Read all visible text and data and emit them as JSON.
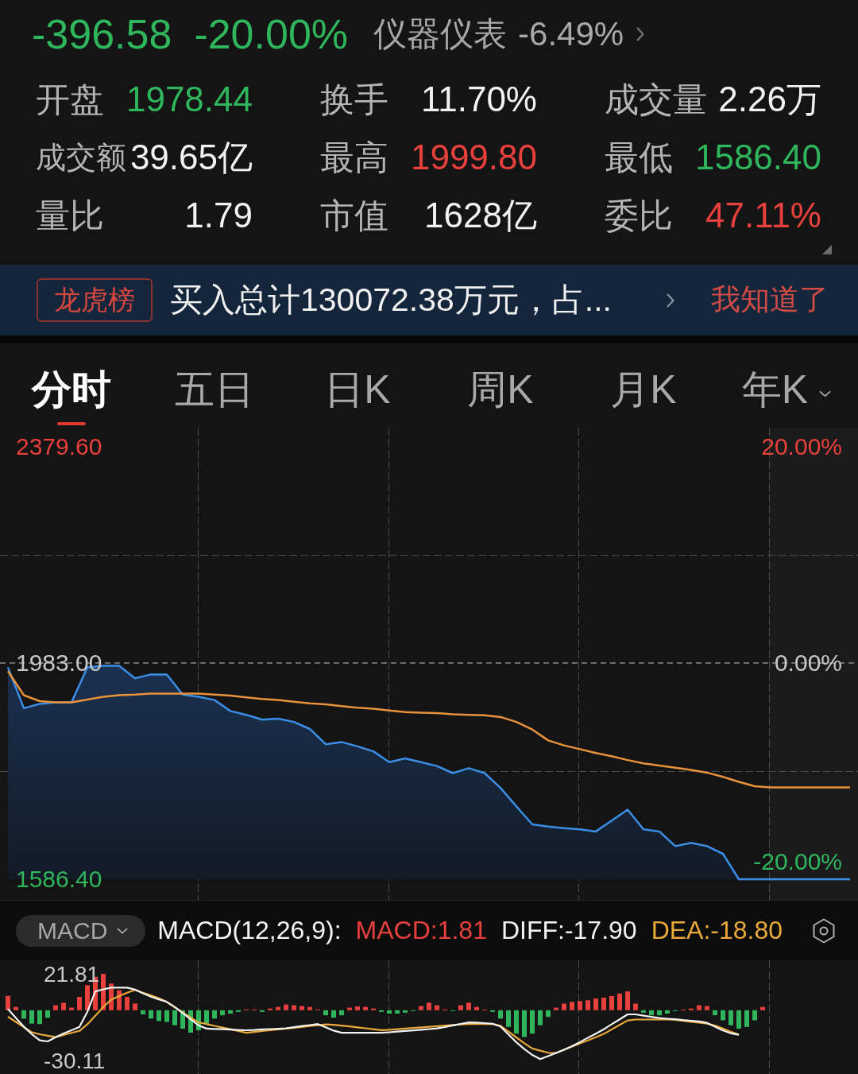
{
  "quote": {
    "change": "-396.58",
    "change_percent": "-20.00%",
    "sector": "仪器仪表",
    "sector_change": "-6.49%"
  },
  "stats": [
    {
      "label": "开盘",
      "value": "1978.44",
      "color": "#2fb55c"
    },
    {
      "label": "换手",
      "value": "11.70%",
      "color": "#f2f2f2"
    },
    {
      "label": "成交量",
      "value": "2.26万",
      "color": "#f2f2f2"
    },
    {
      "label": "成交额",
      "value": "39.65亿",
      "color": "#f2f2f2"
    },
    {
      "label": "最高",
      "value": "1999.80",
      "color": "#e8403c"
    },
    {
      "label": "最低",
      "value": "1586.40",
      "color": "#2fb55c"
    },
    {
      "label": "量比",
      "value": "1.79",
      "color": "#f2f2f2"
    },
    {
      "label": "市值",
      "value": "1628亿",
      "color": "#f2f2f2"
    },
    {
      "label": "委比",
      "value": "47.11%",
      "color": "#e8403c"
    }
  ],
  "banner": {
    "tag": "龙虎榜",
    "text": "买入总计130072.38万元，占...",
    "action": "我知道了"
  },
  "tabs": [
    {
      "label": "分时",
      "selected": true,
      "dropdown": false
    },
    {
      "label": "五日",
      "selected": false,
      "dropdown": false
    },
    {
      "label": "日K",
      "selected": false,
      "dropdown": false
    },
    {
      "label": "周K",
      "selected": false,
      "dropdown": false
    },
    {
      "label": "月K",
      "selected": false,
      "dropdown": false
    },
    {
      "label": "年K",
      "selected": false,
      "dropdown": true
    }
  ],
  "intraday_chart": {
    "chart_data": {
      "type": "line",
      "ylim": [
        1586.4,
        2379.6
      ],
      "yticks": [
        {
          "value": 2379.6,
          "label": "2379.60"
        },
        {
          "value": 1983,
          "label": "1983.00"
        },
        {
          "value": 1586.4,
          "label": "1586.40"
        }
      ],
      "grid": true,
      "ref_lines": [
        {
          "axis": "y",
          "value": 1983
        }
      ],
      "series": [
        {
          "type": "area",
          "color": "#3b8ee6",
          "values": [
            1975,
            1900,
            1908,
            1911,
            1911,
            1975,
            1978,
            1978,
            1955,
            1962,
            1962,
            1925,
            1921,
            1915,
            1895,
            1888,
            1879,
            1881,
            1875,
            1862,
            1834,
            1838,
            1830,
            1821,
            1801,
            1808,
            1801,
            1794,
            1781,
            1790,
            1781,
            1754,
            1720,
            1687,
            1683,
            1680,
            1678,
            1674,
            1694,
            1714,
            1678,
            1674,
            1647,
            1653,
            1647,
            1633,
            1586.4,
            1586.4,
            1586.4,
            1586.4,
            1586.4,
            1586.4,
            1586.4,
            1586.4
          ]
        },
        {
          "color": "#e8923c",
          "values": [
            1968,
            1924,
            1913,
            1911,
            1911,
            1916,
            1921,
            1924,
            1925,
            1927,
            1927,
            1927,
            1927,
            1925,
            1923,
            1920,
            1917,
            1915,
            1912,
            1909,
            1907,
            1904,
            1901,
            1899,
            1896,
            1893,
            1892,
            1891,
            1889,
            1888,
            1887,
            1884,
            1875,
            1861,
            1841,
            1832,
            1825,
            1818,
            1812,
            1805,
            1799,
            1795,
            1791,
            1787,
            1782,
            1774,
            1765,
            1757,
            1755,
            1755,
            1755,
            1755,
            1755,
            1755
          ]
        }
      ]
    },
    "right_labels": [
      "20.00%",
      "0.00%",
      "-20.00%"
    ]
  },
  "indicator": {
    "selector": "MACD",
    "params": "MACD(12,26,9):",
    "readouts": [
      {
        "text": "MACD:1.81",
        "color": "#e8403c"
      },
      {
        "text": "DIFF:-17.90",
        "color": "#f2f2f2"
      },
      {
        "text": "DEA:-18.80",
        "color": "#e8a93a"
      }
    ],
    "chart_data": {
      "type": "line",
      "ylim": [
        -30.11,
        21.81
      ],
      "yticks": [
        {
          "value": 21.81,
          "label": "21.81"
        },
        {
          "value": -30.11,
          "label": "-30.11"
        }
      ],
      "grid": true,
      "series": [
        {
          "type": "bar",
          "color": "#e8403c",
          "values": [
            8.6,
            2.0,
            null,
            null,
            null,
            null,
            3.0,
            4.5,
            1.5,
            8.0,
            15.0,
            20.0,
            21.8,
            16.0,
            12.0,
            8.0,
            4.0,
            null,
            null,
            null,
            null,
            null,
            null,
            null,
            null,
            null,
            null,
            null,
            null,
            null,
            0.5,
            0.5,
            null,
            1.0,
            2.0,
            3.4,
            3.0,
            2.5,
            2.0,
            0.5,
            null,
            null,
            null,
            1.5,
            2.3,
            2.0,
            1.0,
            null,
            null,
            null,
            null,
            null,
            2.5,
            4.5,
            3.0,
            0.5,
            null,
            3.0,
            4.5,
            2.0,
            0.5,
            null,
            null,
            null,
            null,
            null,
            null,
            null,
            null,
            1.5,
            4.0,
            5.0,
            5.5,
            6.0,
            7.0,
            7.5,
            8.5,
            10.0,
            11.3,
            4.0,
            null,
            null,
            null,
            null,
            null,
            0.5,
            1.0,
            3.0,
            2.5,
            null,
            null,
            null,
            null,
            null,
            null,
            2.0
          ]
        },
        {
          "type": "bar",
          "color": "#2fb55c",
          "values": [
            null,
            null,
            -5.0,
            -8.0,
            -8.3,
            -4.5,
            null,
            null,
            null,
            null,
            null,
            null,
            null,
            null,
            null,
            null,
            null,
            -2.5,
            -5.0,
            -6.5,
            -7.0,
            -9.0,
            -11.0,
            -13.5,
            -12.0,
            -8.0,
            -5.0,
            -3.0,
            -2.0,
            -1.0,
            null,
            null,
            -1.0,
            null,
            null,
            null,
            null,
            null,
            null,
            null,
            -3.0,
            -4.5,
            -3.0,
            null,
            null,
            null,
            null,
            -1.0,
            -2.0,
            -2.0,
            -1.5,
            -0.5,
            null,
            null,
            null,
            null,
            -0.5,
            null,
            null,
            null,
            null,
            -1.0,
            -5.0,
            -10.0,
            -14.0,
            -16.0,
            -14.0,
            -9.0,
            -4.0,
            null,
            null,
            null,
            null,
            null,
            null,
            null,
            null,
            null,
            null,
            null,
            -1.5,
            -3.0,
            -3.0,
            -2.0,
            -0.5,
            null,
            null,
            null,
            null,
            -3.0,
            -6.0,
            -9.0,
            -11.0,
            -10.0,
            -6.0,
            null
          ]
        },
        {
          "color": "#e8a93a",
          "values": [
            -3.9,
            -7.0,
            -10.1,
            -13.2,
            -14.4,
            -15.3,
            -16.1,
            -14.8,
            -13.6,
            -12.4,
            -8.4,
            -3.3,
            1.9,
            6.4,
            8.5,
            10.5,
            12.2,
            10.5,
            8.9,
            7.2,
            5.0,
            1.8,
            -1.3,
            -4.5,
            -7.3,
            -8.3,
            -9.4,
            -10.4,
            -11.4,
            -12.5,
            -13.5,
            -13.0,
            -12.5,
            -12.0,
            -11.5,
            -11.0,
            -10.5,
            -10.0,
            -9.5,
            -9.0,
            -8.5,
            -8.7,
            -9.2,
            -9.7,
            -10.3,
            -10.8,
            -11.4,
            -11.9,
            -11.7,
            -11.4,
            -11.0,
            -10.6,
            -10.3,
            -9.9,
            -9.6,
            -9.2,
            -8.8,
            -8.5,
            -8.3,
            -8.3,
            -8.3,
            -8.3,
            -9.3,
            -12.8,
            -16.3,
            -19.8,
            -22.9,
            -24.2,
            -25.5,
            -25.6,
            -23.7,
            -21.8,
            -19.9,
            -18.1,
            -16.2,
            -14.2,
            -11.5,
            -8.8,
            -6.1,
            -5.6,
            -5.6,
            -5.6,
            -5.6,
            -5.6,
            -5.8,
            -6.4,
            -6.9,
            -7.5,
            -8.0,
            -9.2,
            -11.0,
            -12.9,
            -14.7,
            null,
            null,
            null
          ]
        },
        {
          "color": "#f2f2f2",
          "values": [
            0.7,
            -4.6,
            -9.9,
            -14.3,
            -18.0,
            -18.7,
            -16.2,
            -13.9,
            -12.0,
            -10.0,
            -0.9,
            11.3,
            12.5,
            13.5,
            13.5,
            13.5,
            12.4,
            10.1,
            8.1,
            6.5,
            5.0,
            1.9,
            -1.7,
            -5.4,
            -9.1,
            -11.0,
            -11.2,
            -11.4,
            -11.6,
            -11.8,
            -12.0,
            -11.8,
            -11.5,
            -11.3,
            -11.1,
            -10.8,
            -10.2,
            -9.5,
            -8.9,
            -8.3,
            -10.2,
            -12.2,
            -13.5,
            -13.5,
            -13.5,
            -13.5,
            -13.5,
            -13.5,
            -13.2,
            -12.8,
            -12.4,
            -12.1,
            -11.7,
            -11.3,
            -10.9,
            -10.1,
            -9.1,
            -8.2,
            -7.3,
            -7.4,
            -7.7,
            -8.1,
            -9.7,
            -14.5,
            -19.2,
            -23.3,
            -26.8,
            -29.3,
            -27.5,
            -25.6,
            -23.7,
            -21.6,
            -19.1,
            -16.5,
            -14.0,
            -11.4,
            -8.4,
            -5.5,
            -2.5,
            -2.5,
            -3.3,
            -4.0,
            -4.7,
            -5.1,
            -5.4,
            -5.9,
            -6.3,
            -6.7,
            -7.6,
            -9.8,
            -12.1,
            -13.8,
            -14.7,
            null,
            null,
            null
          ]
        }
      ]
    }
  }
}
